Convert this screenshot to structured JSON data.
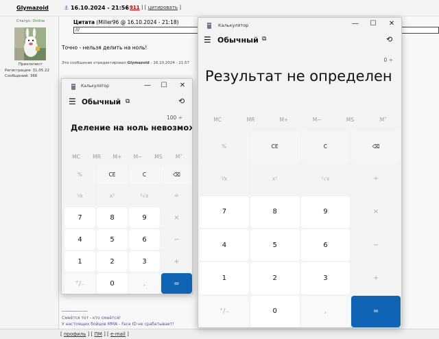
{
  "forum": {
    "username": "Glymazoid",
    "post_date": "16.10.2024 - 21:56",
    "post_number": "911",
    "quote_link": "цитировать",
    "status_label": "Статус:",
    "status_value": "Online",
    "rank": "Прихлопист",
    "registration": "Регистрация: 31.05.22",
    "messages": "Сообщений: 366",
    "quote_title": "Цитата",
    "quote_author": "(Miller96 @ 16.10.2024 - 21:18)",
    "quote_text": "///",
    "post_text": "Точно - нельзя делить на ноль!",
    "edit_note_prefix": "Это сообщение отредактировал",
    "edit_note_user": "Glymazoid",
    "edit_note_date": "- 16.10.2024 - 21:57",
    "signature_line": "--------------------",
    "signature_1": "Смеётся тот - кто смеётся!",
    "signature_2": "У настоящих бойцов ММА - Face ID не срабатывает!",
    "bottom_links": [
      "профиль",
      "ПМ",
      "e-mail"
    ]
  },
  "calc_small": {
    "title": "Калькулятор",
    "mode": "Обычный",
    "expression": "100 ÷",
    "result": "Деление на ноль невозможно",
    "memory": [
      "MC",
      "MR",
      "M+",
      "M−",
      "MS",
      "M˅"
    ],
    "keys": [
      "%",
      "CE",
      "C",
      "⌫",
      "⅟x",
      "x²",
      "²√x",
      "÷",
      "7",
      "8",
      "9",
      "×",
      "4",
      "5",
      "6",
      "−",
      "1",
      "2",
      "3",
      "+",
      "⁺/₋",
      "0",
      ",",
      "="
    ]
  },
  "calc_big": {
    "title": "Калькулятор",
    "mode": "Обычный",
    "expression": "0 ÷",
    "result": "Результат не определен",
    "memory": [
      "MC",
      "MR",
      "M+",
      "M−",
      "MS",
      "M˅"
    ],
    "keys": [
      "%",
      "CE",
      "C",
      "⌫",
      "⅟x",
      "x²",
      "²√x",
      "÷",
      "7",
      "8",
      "9",
      "×",
      "4",
      "5",
      "6",
      "−",
      "1",
      "2",
      "3",
      "+",
      "⁺/₋",
      "0",
      ",",
      "="
    ]
  },
  "icons": {
    "pin": "pin-icon",
    "menu": "hamburger-menu-icon",
    "mode": "keep-on-top-icon",
    "history": "history-icon"
  }
}
